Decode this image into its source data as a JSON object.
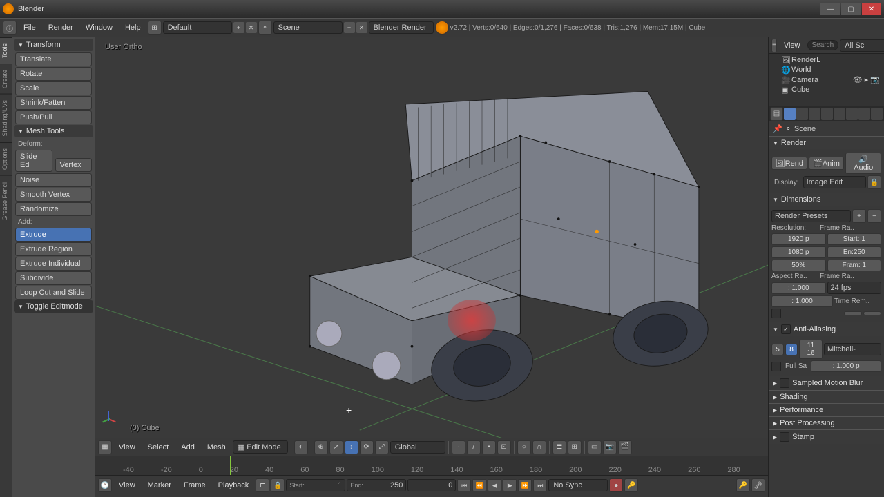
{
  "app": {
    "title": "Blender"
  },
  "topbar": {
    "menus": [
      "File",
      "Render",
      "Window",
      "Help"
    ],
    "layout_selector": "Default",
    "scene_selector": "Scene",
    "engine_selector": "Blender Render",
    "stats": "v2.72 | Verts:0/640 | Edges:0/1,276 | Faces:0/638 | Tris:1,276 | Mem:17.15M | Cube"
  },
  "left": {
    "tabs": [
      "Tools",
      "Create",
      "Shading/UVs",
      "Options",
      "Grease Pencil"
    ],
    "transform_header": "Transform",
    "transform": [
      "Translate",
      "Rotate",
      "Scale",
      "Shrink/Fatten",
      "Push/Pull"
    ],
    "meshtools_header": "Mesh Tools",
    "deform_label": "Deform:",
    "slide_ed": "Slide Ed",
    "vertex": "Vertex",
    "noise": "Noise",
    "smooth_vertex": "Smooth Vertex",
    "randomize": "Randomize",
    "add_label": "Add:",
    "extrude": "Extrude",
    "extrude_region": "Extrude Region",
    "extrude_individual": "Extrude Individual",
    "subdivide": "Subdivide",
    "loop_cut": "Loop Cut and Slide",
    "toggle_editmode": "Toggle Editmode"
  },
  "viewport": {
    "header": "User Ortho",
    "object_label": "(0) Cube"
  },
  "vp_toolbar": {
    "view": "View",
    "select": "Select",
    "add": "Add",
    "mesh": "Mesh",
    "mode": "Edit Mode",
    "orientation": "Global"
  },
  "timeline": {
    "ticks": [
      "-40",
      "-20",
      "0",
      "20",
      "40",
      "60",
      "80",
      "100",
      "120",
      "140",
      "160",
      "180",
      "200",
      "220",
      "240",
      "260",
      "280"
    ],
    "view": "View",
    "marker": "Marker",
    "frame": "Frame",
    "playback": "Playback",
    "start_label": "Start:",
    "start_val": "1",
    "end_label": "End:",
    "end_val": "250",
    "current_val": "0",
    "sync": "No Sync"
  },
  "outliner": {
    "view": "View",
    "search_placeholder": "Search",
    "all_sc": "All Sc",
    "items": [
      {
        "name": "RenderL"
      },
      {
        "name": "World"
      },
      {
        "name": "Camera"
      },
      {
        "name": "Cube"
      }
    ]
  },
  "properties": {
    "breadcrumb": "Scene",
    "render_header": "Render",
    "render_btn": "Rend",
    "anim_btn": "Anim",
    "audio_btn": "Audio",
    "display_label": "Display:",
    "display_value": "Image Edit",
    "dimensions_header": "Dimensions",
    "render_presets": "Render Presets",
    "resolution_label": "Resolution:",
    "res_x": "1920 p",
    "res_y": "1080 p",
    "res_pct": "50%",
    "frame_range_label": "Frame Ra..",
    "frame_start": "Start: 1",
    "frame_end": "En:250",
    "frame_step": "Fram: 1",
    "aspect_label": "Aspect Ra..",
    "aspect_x": ": 1.000",
    "aspect_y": ": 1.000",
    "frame_rate_label": "Frame Ra..",
    "fps": "24 fps",
    "time_remap_label": "Time Rem..",
    "aa_header": "Anti-Aliasing",
    "aa_5": "5",
    "aa_8": "8",
    "aa_1116": "11 16",
    "aa_filter": "Mitchell-",
    "full_sample": "Full Sa",
    "aa_size": ": 1.000 p",
    "sampled_mb": "Sampled Motion Blur",
    "shading": "Shading",
    "performance": "Performance",
    "post_processing": "Post Processing",
    "stamp": "Stamp"
  }
}
